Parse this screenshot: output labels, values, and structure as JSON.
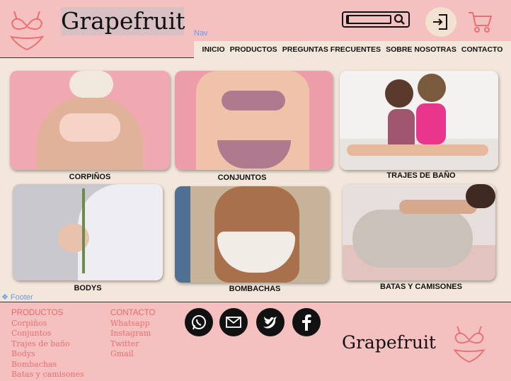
{
  "header": {
    "brand": "Grapefruit",
    "nav_annotation": "Nav",
    "nav": [
      "INICIO",
      "PRODUCTOS",
      "PREGUNTAS FRECUENTES",
      "SOBRE NOSOTRAS",
      "CONTACTO"
    ]
  },
  "categories": [
    {
      "label": "CORPIÑOS",
      "bg": "#f0a9b0",
      "skin": "#e0b29a",
      "garment": "#f6d2c7"
    },
    {
      "label": "CONJUNTOS",
      "bg": "#ec9da8",
      "skin": "#f1c2aa",
      "garment": "#b07a8e"
    },
    {
      "label": "TRAJES DE BAÑO",
      "bg": "#f4f2f0",
      "skin": "#e7b89c",
      "garment": "#e8368c"
    },
    {
      "label": "BODYS",
      "bg": "#c9c9cd",
      "skin": "#e8c2ad",
      "garment": "#eeeef2"
    },
    {
      "label": "BOMBACHAS",
      "bg": "#c7b39a",
      "skin": "#a9704c",
      "garment": "#f2ece7"
    },
    {
      "label": "BATAS Y CAMISONES",
      "bg": "#e6dfdc",
      "skin": "#d6a98e",
      "garment": "#cbc1bb"
    }
  ],
  "footer": {
    "annotation": "Footer",
    "products_head": "PRODUCTOS",
    "products": [
      "Corpiños",
      "Conjuntos",
      "Trajes de baño",
      "Bodys",
      "Bombachas",
      "Batas y camisones"
    ],
    "contact_head": "CONTACTO",
    "contact": [
      "Whatsapp",
      "Instagram",
      "Twitter",
      "Gmail"
    ],
    "brand": "Grapefruit"
  },
  "colors": {
    "header_bg": "#f5c0c0",
    "accent": "#ec6f6f",
    "body_bg": "#f3e6da"
  },
  "icons": [
    "bikini-logo-icon",
    "search-icon",
    "login-icon",
    "cart-icon",
    "whatsapp-icon",
    "mail-icon",
    "twitter-icon",
    "facebook-icon"
  ]
}
